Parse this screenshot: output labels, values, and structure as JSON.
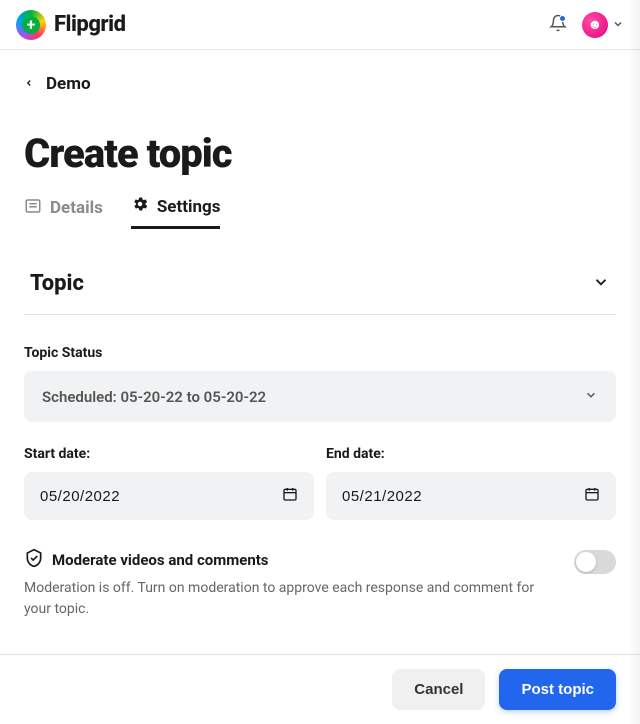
{
  "brand": {
    "name": "Flipgrid"
  },
  "breadcrumb": {
    "label": "Demo"
  },
  "page": {
    "title": "Create topic"
  },
  "tabs": {
    "details": {
      "label": "Details"
    },
    "settings": {
      "label": "Settings"
    }
  },
  "section": {
    "title": "Topic"
  },
  "fields": {
    "status": {
      "label": "Topic Status",
      "value": "Scheduled: 05-20-22 to 05-20-22"
    },
    "start": {
      "label": "Start date:",
      "value": "05/20/2022"
    },
    "end": {
      "label": "End date:",
      "value": "05/21/2022"
    }
  },
  "moderate": {
    "title": "Moderate videos and comments",
    "description": "Moderation is off. Turn on moderation to approve each response and comment for your topic.",
    "enabled": false
  },
  "footer": {
    "cancel": "Cancel",
    "submit": "Post topic"
  }
}
